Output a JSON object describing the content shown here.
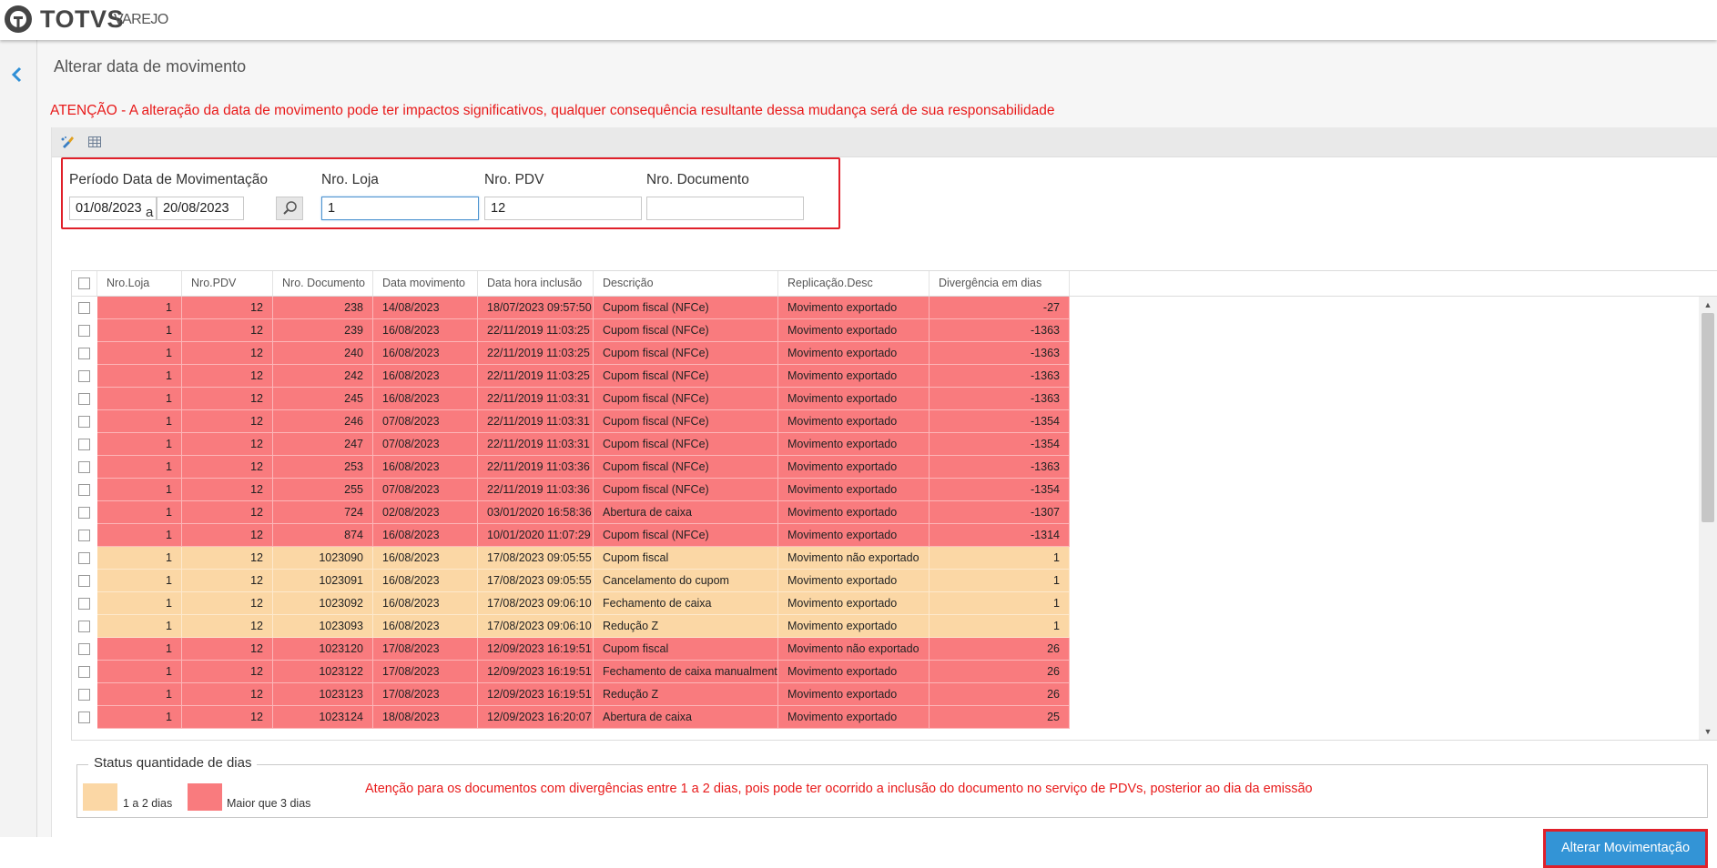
{
  "header": {
    "brand": "TOTVS",
    "product": "VAREJO"
  },
  "page": {
    "title": "Alterar data de movimento",
    "warning": "ATENÇÃO - A alteração da data de movimento pode ter impactos significativos, qualquer consequência resultante dessa mudança será de sua responsabilidade"
  },
  "toolbar": {
    "icons": [
      "brush-icon",
      "grid-icon"
    ]
  },
  "filters": {
    "period_label": "Período Data de Movimentação",
    "date_from": "01/08/2023",
    "separator": "a",
    "date_to": "20/08/2023",
    "loja_label": "Nro. Loja",
    "loja_value": "1",
    "pdv_label": "Nro. PDV",
    "pdv_value": "12",
    "doc_label": "Nro. Documento",
    "doc_value": ""
  },
  "table": {
    "headers": [
      "Nro.Loja",
      "Nro.PDV",
      "Nro. Documento",
      "Data movimento",
      "Data hora inclusão",
      "Descrição",
      "Replicação.Desc",
      "Divergência em dias"
    ],
    "rows": [
      {
        "status": "red",
        "loja": "1",
        "pdv": "12",
        "doc": "238",
        "data_mov": "14/08/2023",
        "data_inc": "18/07/2023 09:57:50",
        "desc": "Cupom fiscal (NFCe)",
        "replic": "Movimento exportado",
        "div": "-27"
      },
      {
        "status": "red",
        "loja": "1",
        "pdv": "12",
        "doc": "239",
        "data_mov": "16/08/2023",
        "data_inc": "22/11/2019 11:03:25",
        "desc": "Cupom fiscal (NFCe)",
        "replic": "Movimento exportado",
        "div": "-1363"
      },
      {
        "status": "red",
        "loja": "1",
        "pdv": "12",
        "doc": "240",
        "data_mov": "16/08/2023",
        "data_inc": "22/11/2019 11:03:25",
        "desc": "Cupom fiscal (NFCe)",
        "replic": "Movimento exportado",
        "div": "-1363"
      },
      {
        "status": "red",
        "loja": "1",
        "pdv": "12",
        "doc": "242",
        "data_mov": "16/08/2023",
        "data_inc": "22/11/2019 11:03:25",
        "desc": "Cupom fiscal (NFCe)",
        "replic": "Movimento exportado",
        "div": "-1363"
      },
      {
        "status": "red",
        "loja": "1",
        "pdv": "12",
        "doc": "245",
        "data_mov": "16/08/2023",
        "data_inc": "22/11/2019 11:03:31",
        "desc": "Cupom fiscal (NFCe)",
        "replic": "Movimento exportado",
        "div": "-1363"
      },
      {
        "status": "red",
        "loja": "1",
        "pdv": "12",
        "doc": "246",
        "data_mov": "07/08/2023",
        "data_inc": "22/11/2019 11:03:31",
        "desc": "Cupom fiscal (NFCe)",
        "replic": "Movimento exportado",
        "div": "-1354"
      },
      {
        "status": "red",
        "loja": "1",
        "pdv": "12",
        "doc": "247",
        "data_mov": "07/08/2023",
        "data_inc": "22/11/2019 11:03:31",
        "desc": "Cupom fiscal (NFCe)",
        "replic": "Movimento exportado",
        "div": "-1354"
      },
      {
        "status": "red",
        "loja": "1",
        "pdv": "12",
        "doc": "253",
        "data_mov": "16/08/2023",
        "data_inc": "22/11/2019 11:03:36",
        "desc": "Cupom fiscal (NFCe)",
        "replic": "Movimento exportado",
        "div": "-1363"
      },
      {
        "status": "red",
        "loja": "1",
        "pdv": "12",
        "doc": "255",
        "data_mov": "07/08/2023",
        "data_inc": "22/11/2019 11:03:36",
        "desc": "Cupom fiscal (NFCe)",
        "replic": "Movimento exportado",
        "div": "-1354"
      },
      {
        "status": "red",
        "loja": "1",
        "pdv": "12",
        "doc": "724",
        "data_mov": "02/08/2023",
        "data_inc": "03/01/2020 16:58:36",
        "desc": "Abertura de caixa",
        "replic": "Movimento exportado",
        "div": "-1307"
      },
      {
        "status": "red",
        "loja": "1",
        "pdv": "12",
        "doc": "874",
        "data_mov": "16/08/2023",
        "data_inc": "10/01/2020 11:07:29",
        "desc": "Cupom fiscal (NFCe)",
        "replic": "Movimento exportado",
        "div": "-1314"
      },
      {
        "status": "orange",
        "loja": "1",
        "pdv": "12",
        "doc": "1023090",
        "data_mov": "16/08/2023",
        "data_inc": "17/08/2023 09:05:55",
        "desc": "Cupom fiscal",
        "replic": "Movimento não exportado",
        "div": "1"
      },
      {
        "status": "orange",
        "loja": "1",
        "pdv": "12",
        "doc": "1023091",
        "data_mov": "16/08/2023",
        "data_inc": "17/08/2023 09:05:55",
        "desc": "Cancelamento do cupom",
        "replic": "Movimento exportado",
        "div": "1"
      },
      {
        "status": "orange",
        "loja": "1",
        "pdv": "12",
        "doc": "1023092",
        "data_mov": "16/08/2023",
        "data_inc": "17/08/2023 09:06:10",
        "desc": "Fechamento de caixa",
        "replic": "Movimento exportado",
        "div": "1"
      },
      {
        "status": "orange",
        "loja": "1",
        "pdv": "12",
        "doc": "1023093",
        "data_mov": "16/08/2023",
        "data_inc": "17/08/2023 09:06:10",
        "desc": "Redução Z",
        "replic": "Movimento exportado",
        "div": "1"
      },
      {
        "status": "red",
        "loja": "1",
        "pdv": "12",
        "doc": "1023120",
        "data_mov": "17/08/2023",
        "data_inc": "12/09/2023 16:19:51",
        "desc": "Cupom fiscal",
        "replic": "Movimento não exportado",
        "div": "26"
      },
      {
        "status": "red",
        "loja": "1",
        "pdv": "12",
        "doc": "1023122",
        "data_mov": "17/08/2023",
        "data_inc": "12/09/2023 16:19:51",
        "desc": "Fechamento de caixa manualmente",
        "replic": "Movimento exportado",
        "div": "26"
      },
      {
        "status": "red",
        "loja": "1",
        "pdv": "12",
        "doc": "1023123",
        "data_mov": "17/08/2023",
        "data_inc": "12/09/2023 16:19:51",
        "desc": "Redução Z",
        "replic": "Movimento exportado",
        "div": "26"
      },
      {
        "status": "red",
        "loja": "1",
        "pdv": "12",
        "doc": "1023124",
        "data_mov": "18/08/2023",
        "data_inc": "12/09/2023 16:20:07",
        "desc": "Abertura de caixa",
        "replic": "Movimento exportado",
        "div": "25"
      }
    ]
  },
  "legend": {
    "title": "Status quantidade de dias",
    "item1_label": "1 a 2 dias",
    "item2_label": "Maior que 3 dias",
    "note": "Atenção para os documentos com divergências entre 1 a 2 dias, pois pode ter ocorrido a inclusão do documento no serviço de PDVs, posterior ao dia da emissão"
  },
  "actions": {
    "submit_label": "Alterar Movimentação"
  },
  "colors": {
    "red_status": "#f97b7e",
    "orange_status": "#fbd7a5",
    "warning_text": "#e81a1a",
    "primary_button": "#3394d6",
    "highlight_border": "#e0202a"
  }
}
